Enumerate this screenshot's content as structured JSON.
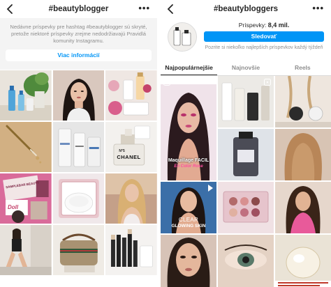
{
  "left": {
    "title": "#beautyblogger",
    "notice": "Nedávne príspevky pre hashtag #beautyblogger sú skryté, pretože niektoré príspevky zrejme nedodržiavajú Pravidlá komunity Instagramu.",
    "info_button": "Viac informácií",
    "tiles": [
      {
        "desc": "skincare bottles and plant"
      },
      {
        "desc": "woman portrait"
      },
      {
        "desc": "makeup products"
      },
      {
        "desc": "serum dropper"
      },
      {
        "desc": "skincare bottles"
      },
      {
        "desc": "chanel perfume"
      },
      {
        "desc": "sample boxes"
      },
      {
        "desc": "cream jar"
      },
      {
        "desc": "blonde woman"
      },
      {
        "desc": "woman sitting"
      },
      {
        "desc": "gucci bag"
      },
      {
        "desc": "brushes"
      }
    ],
    "tile_texts": {
      "chanel": "CHANEL",
      "chanel_no": "N°5",
      "box_text": "SAMPLEBAR BEAUTY",
      "dolls": "Doll"
    }
  },
  "right": {
    "title": "#beautybloggers",
    "posts_label": "Príspevky:",
    "posts_count": "8,4 mil.",
    "follow_button": "Sledovať",
    "follow_note": "Pozrite si niekoľko najlepších príspevkov každý týždeň",
    "tabs": [
      "Najpopulárnejšie",
      "Najnovšie",
      "Reels"
    ],
    "active_tab": 0,
    "captions": {
      "maquillage_line1": "Maquillage FACIL",
      "maquillage_line2": "En Color Rose",
      "clear_line1": "CLEAR",
      "clear_line2": "GLOWING SKIN"
    }
  },
  "colors": {
    "accent": "#0095f6",
    "text": "#262626",
    "muted": "#8e8e8e",
    "notice_bg": "#f4f4f4"
  },
  "icons": [
    "back-arrow-icon",
    "more-options-icon",
    "reels-icon",
    "play-icon"
  ]
}
